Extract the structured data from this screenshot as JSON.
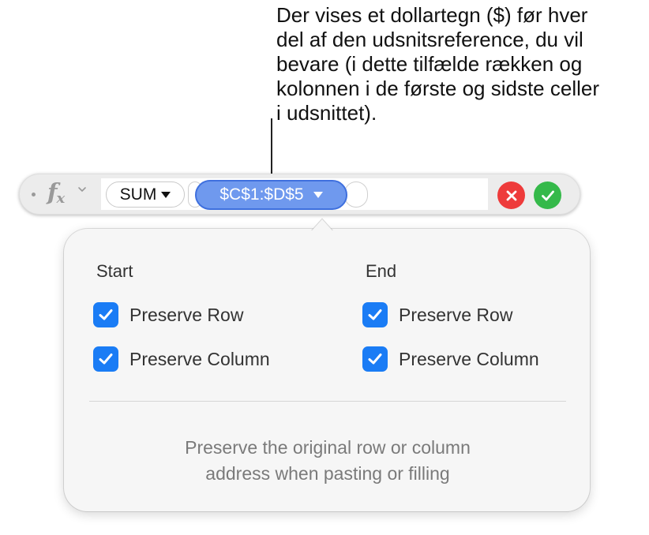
{
  "callout": {
    "lines": [
      "Der vises et dollartegn ($) før hver",
      "del af den udsnitsreference, du vil",
      "bevare (i dette tilfælde rækken og",
      "kolonnen i de første og sidste celler",
      "i udsnittet)."
    ]
  },
  "formula_bar": {
    "fx_symbol": "f",
    "fx_subscript": "x",
    "function_token": "SUM",
    "range_token": "$C$1:$D$5",
    "icons": {
      "fx": "function-icon",
      "fx_menu": "chevron-down-icon",
      "cancel": "x-mark-icon",
      "accept": "checkmark-icon"
    },
    "colors": {
      "range_token_fill": "#6f99ee",
      "range_token_border": "#3f70de",
      "cancel": "#ee3b3b",
      "accept": "#35b94a"
    }
  },
  "popover": {
    "start": {
      "title": "Start",
      "preserve_row": {
        "label": "Preserve Row",
        "checked": true
      },
      "preserve_column": {
        "label": "Preserve Column",
        "checked": true
      }
    },
    "end": {
      "title": "End",
      "preserve_row": {
        "label": "Preserve Row",
        "checked": true
      },
      "preserve_column": {
        "label": "Preserve Column",
        "checked": true
      }
    },
    "hint_lines": [
      "Preserve the original row or column",
      "address when pasting or filling"
    ],
    "checkbox_color": "#1a7cf5"
  }
}
